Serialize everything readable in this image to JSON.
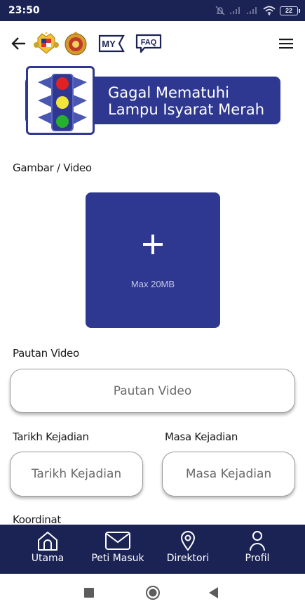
{
  "status_bar": {
    "time": "23:50",
    "battery": "22",
    "icons": [
      "mute-icon",
      "signal-icon",
      "signal-icon",
      "wifi-icon",
      "battery-icon"
    ]
  },
  "header": {
    "lang_label": "MY",
    "faq_label": "FAQ",
    "icons": [
      "back-arrow-icon",
      "jata-negara-crest",
      "pdrm-crest",
      "hamburger-menu-icon"
    ]
  },
  "banner": {
    "title_line1": "Gagal Mematuhi",
    "title_line2": "Lampu Isyarat Merah"
  },
  "form": {
    "media_label": "Gambar / Video",
    "upload_hint": "Max 20MB",
    "video_link_label": "Pautan Video",
    "video_link_placeholder": "Pautan Video",
    "date_label": "Tarikh Kejadian",
    "date_placeholder": "Tarikh Kejadian",
    "time_label": "Masa Kejadian",
    "time_placeholder": "Masa Kejadian",
    "coord_label": "Koordinat"
  },
  "bottom_nav": {
    "items": [
      {
        "label": "Utama",
        "icon": "home-icon"
      },
      {
        "label": "Peti Masuk",
        "icon": "mail-icon"
      },
      {
        "label": "Direktori",
        "icon": "location-pin-icon"
      },
      {
        "label": "Profil",
        "icon": "user-icon"
      }
    ]
  },
  "colors": {
    "navy": "#1b2355",
    "brand_blue": "#2f3890",
    "white": "#ffffff"
  }
}
